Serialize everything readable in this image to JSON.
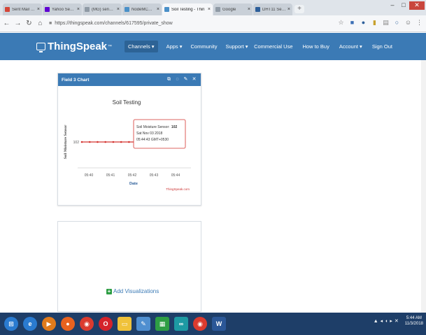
{
  "browser": {
    "tabs": [
      {
        "label": "Sent Mail - gondo",
        "color": "#d44638",
        "active": false
      },
      {
        "label": "Yahoo Search - Wi",
        "color": "#6001d2",
        "active": false
      },
      {
        "label": "(MG) sensor - Go",
        "color": "#8f9aa5",
        "active": false
      },
      {
        "label": "NodeMCU Tempera",
        "color": "#4a90c8",
        "active": false
      },
      {
        "label": "Soil Testing - Thin",
        "color": "#4a90c8",
        "active": true
      },
      {
        "label": "Google",
        "color": "#8f9aa5",
        "active": false
      },
      {
        "label": "DHT11 Sensor Inte",
        "color": "#2d5f9a",
        "active": false
      }
    ],
    "address": "https://thingspeak.com/channels/617595/private_show"
  },
  "navbar": {
    "brand": "ThingSpeak",
    "tm": "™",
    "left_items": [
      "Channels ▾",
      "Apps ▾",
      "Community",
      "Support ▾"
    ],
    "right_items": [
      "Commercial Use",
      "How to Buy",
      "Account ▾",
      "Sign Out"
    ]
  },
  "card": {
    "title": "Field 3 Chart"
  },
  "chart_data": {
    "type": "line",
    "title": "Soil Testing",
    "xlabel": "Date",
    "ylabel": "Soil Moisture Sensor",
    "x_ticks": [
      "05:40",
      "05:41",
      "05:42",
      "05:43",
      "05:44"
    ],
    "y_ticks": [
      "102"
    ],
    "series": [
      {
        "name": "Soil Moisture Sensor",
        "color": "#d4332f",
        "values": [
          102,
          102,
          102,
          102,
          102,
          102,
          102,
          102,
          102,
          102,
          102,
          102,
          102,
          102
        ]
      }
    ],
    "tooltip": {
      "line1_label": "Soil Moisture Sensor:",
      "line1_value": "102",
      "line2": "Sat Nov 03 2018",
      "line3": "05:44:43 GMT+0530"
    },
    "credit": "ThingSpeak.com"
  },
  "add_visualizations": "Add Visualizations",
  "taskbar": {
    "clock_time": "5:44 AM",
    "clock_date": "11/3/2018"
  }
}
